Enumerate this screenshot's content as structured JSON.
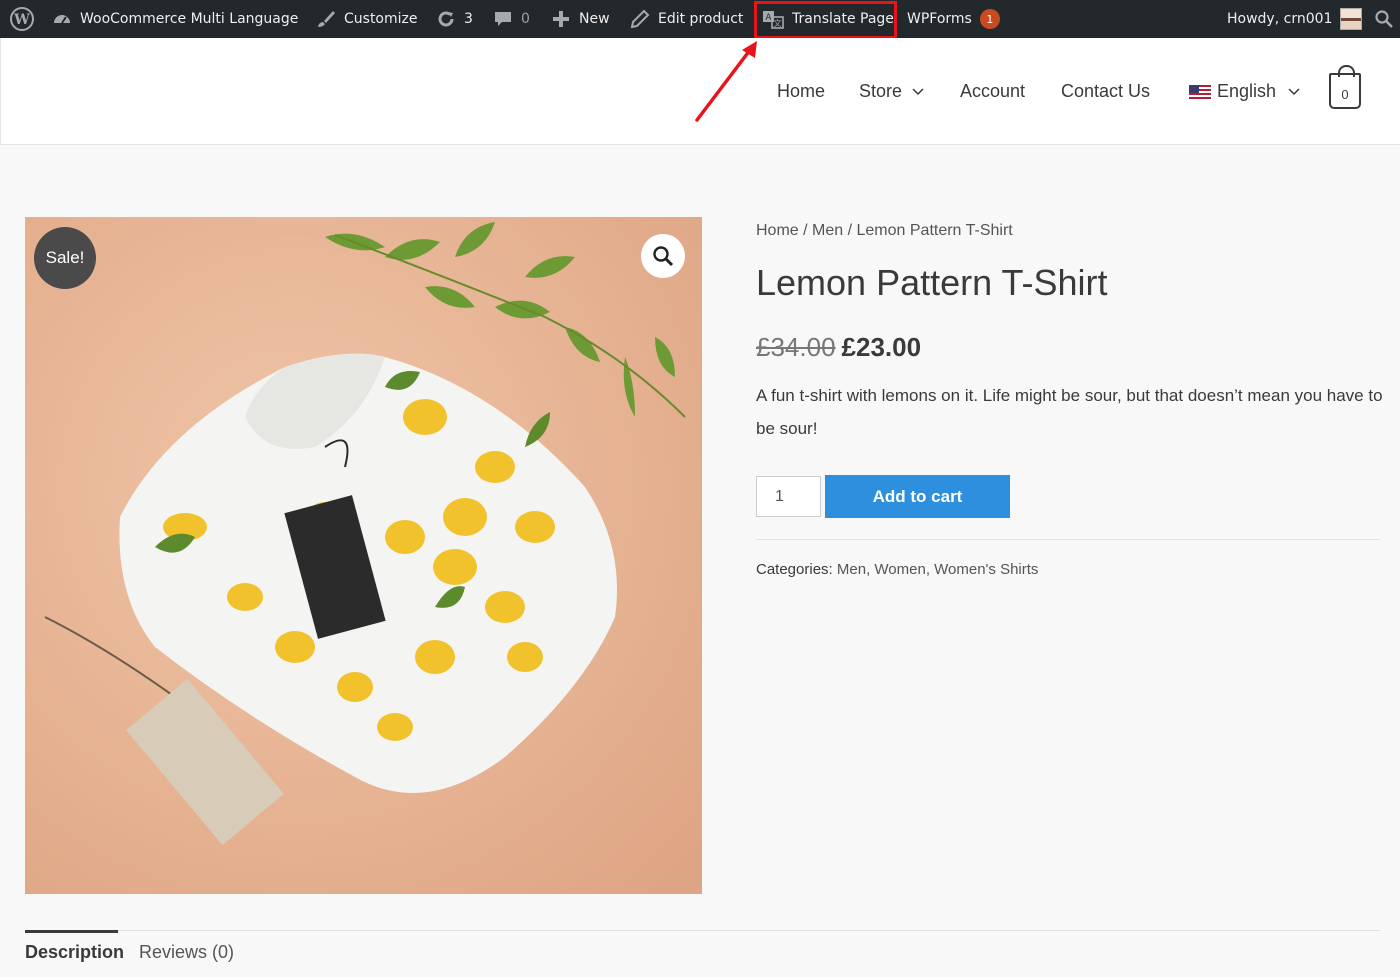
{
  "adminbar": {
    "site_name": "WooCommerce Multi Language",
    "customize": "Customize",
    "updates_count": "3",
    "comments_count": "0",
    "new": "New",
    "edit_product": "Edit product",
    "translate_page": "Translate Page",
    "wpforms": "WPForms",
    "wpforms_badge": "1",
    "howdy": "Howdy, crn001"
  },
  "nav": {
    "home": "Home",
    "store": "Store",
    "account": "Account",
    "contact": "Contact Us",
    "language": "English",
    "cart_count": "0"
  },
  "product": {
    "sale_badge": "Sale!",
    "breadcrumb": {
      "home": "Home",
      "sep1": " / ",
      "category": "Men",
      "sep2": " / ",
      "current": "Lemon Pattern T-Shirt"
    },
    "title": "Lemon Pattern T-Shirt",
    "price_old": "£34.00",
    "price_new": "£23.00",
    "short_description": "A fun t-shirt with lemons on it. Life might be sour, but that doesn’t mean you have to be sour!",
    "quantity": "1",
    "add_to_cart": "Add to cart",
    "categories_label": "Categories:",
    "categories": "Men, Women, Women's Shirts"
  },
  "tabs": {
    "description": "Description",
    "reviews": "Reviews (0)"
  },
  "colors": {
    "adminbar_bg": "#23282d",
    "accent_button": "#2e8fde",
    "highlight": "#e8141c",
    "badge": "#ca4a1f"
  },
  "icons": [
    "wordpress-icon",
    "dashboard-icon",
    "brush-icon",
    "updates-icon",
    "comment-icon",
    "plus-icon",
    "pencil-icon",
    "translate-icon",
    "search-icon",
    "chevron-down-icon",
    "flag-us-icon",
    "shopping-bag-icon",
    "zoom-icon"
  ]
}
